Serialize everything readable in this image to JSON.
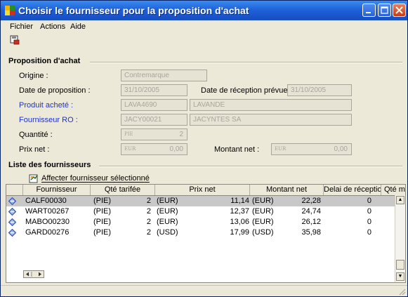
{
  "window": {
    "title": "Choisir le fournisseur pour la proposition d'achat",
    "controls": [
      "minimize-icon",
      "maximize-icon",
      "close-icon"
    ]
  },
  "menu": {
    "items": [
      "Fichier",
      "Actions",
      "Aide"
    ]
  },
  "toolbar": {
    "icons": [
      "save-icon"
    ]
  },
  "proposition": {
    "section_title": "Proposition d'achat",
    "origine_label": "Origine :",
    "origine_value": "Contremarque",
    "date_label": "Date de proposition :",
    "date_value": "31/10/2005",
    "reception_label": "Date de réception prévue :",
    "reception_value": "31/10/2005",
    "produit_label": "Produit acheté :",
    "produit_code": "LAVA4690",
    "produit_name": "LAVANDE",
    "fournisseur_label": "Fournisseur RO :",
    "fournisseur_code": "JACY00021",
    "fournisseur_name": "JACYNTES SA",
    "quantite_label": "Quantité :",
    "quantite_unit": "PIE",
    "quantite_value": "2",
    "prixnet_label": "Prix net :",
    "prixnet_unit": "EUR",
    "prixnet_value": "0,00",
    "montant_label": "Montant net :",
    "montant_unit": "EUR",
    "montant_value": "0,00"
  },
  "suppliers": {
    "section_title": "Liste des fournisseurs",
    "assign_label": "Affecter fournisseur sélectionné",
    "columns": [
      "Fournisseur",
      "Qté tarifée",
      "Prix net",
      "Montant net",
      "Delai de réception",
      "Qté m"
    ],
    "rows": [
      {
        "code": "CALF00030",
        "unit": "(PIE)",
        "qty": "2",
        "cur1": "(EUR)",
        "prix": "11,14",
        "cur2": "(EUR)",
        "montant": "22,28",
        "delai": "0",
        "selected": true
      },
      {
        "code": "WART00267",
        "unit": "(PIE)",
        "qty": "2",
        "cur1": "(EUR)",
        "prix": "12,37",
        "cur2": "(EUR)",
        "montant": "24,74",
        "delai": "0",
        "selected": false
      },
      {
        "code": "MABO00230",
        "unit": "(PIE)",
        "qty": "2",
        "cur1": "(EUR)",
        "prix": "13,06",
        "cur2": "(EUR)",
        "montant": "26,12",
        "delai": "0",
        "selected": false
      },
      {
        "code": "GARD00276",
        "unit": "(PIE)",
        "qty": "2",
        "cur1": "(USD)",
        "prix": "17,99",
        "cur2": "(USD)",
        "montant": "35,98",
        "delai": "0",
        "selected": false
      }
    ]
  },
  "colors": {
    "titlebar": "#1f62d8",
    "label_blue": "#1c34c8",
    "selected_row": "#c8c8c8"
  }
}
